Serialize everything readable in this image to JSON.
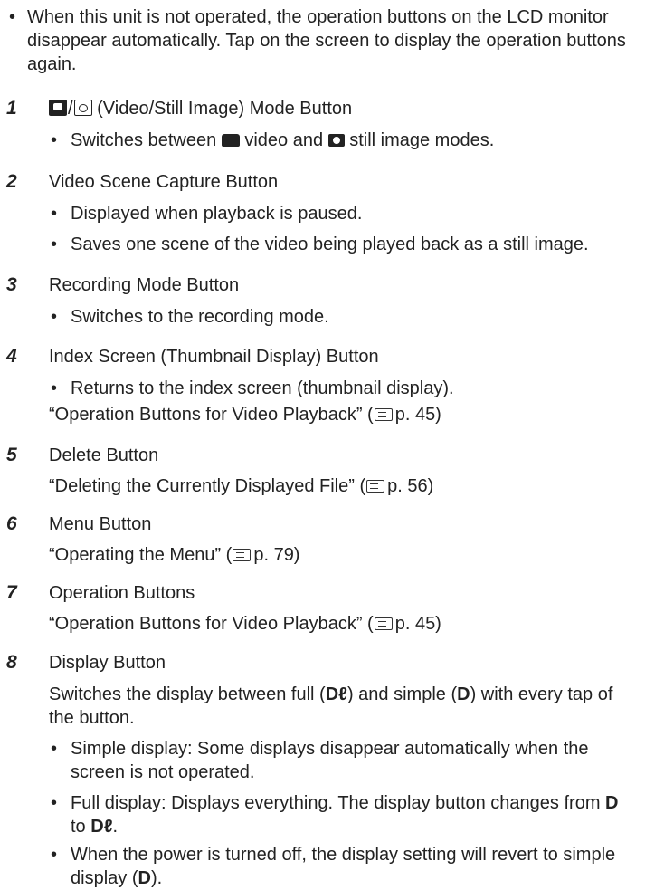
{
  "intro": "When this unit is not operated, the operation buttons on the LCD monitor disappear automatically. Tap on the screen to display the operation buttons again.",
  "items": [
    {
      "num": "1",
      "title": "(Video/Still Image) Mode Button",
      "icons": [
        "video-mode-icon",
        "still-mode-icon"
      ],
      "bullets_a": "Switches between",
      "bullets_b": "video and",
      "bullets_c": "still image modes."
    },
    {
      "num": "2",
      "title": "Video Scene Capture Button",
      "bullets": [
        "Displayed when playback is paused.",
        "Saves one scene of the video being played back as a still image."
      ]
    },
    {
      "num": "3",
      "title": "Recording Mode Button",
      "bullets": [
        "Switches to the recording mode."
      ]
    },
    {
      "num": "4",
      "title": "Index Screen (Thumbnail Display) Button",
      "bullets": [
        "Returns to the index screen (thumbnail display)."
      ],
      "ref_text": "“Operation Buttons for Video Playback” (",
      "ref_page": "p. 45)"
    },
    {
      "num": "5",
      "title": "Delete Button",
      "ref_text": "“Deleting the Currently Displayed File” (",
      "ref_page": "p. 56)"
    },
    {
      "num": "6",
      "title": "Menu Button",
      "ref_text": "“Operating the Menu” (",
      "ref_page": "p. 79)"
    },
    {
      "num": "7",
      "title": "Operation Buttons",
      "ref_text": "“Operation Buttons for Video Playback” (",
      "ref_page": "p. 45)"
    },
    {
      "num": "8",
      "title": "Display Button",
      "desc_a": "Switches the display between full (",
      "desc_b": ") and simple (",
      "desc_c": ") with every tap of",
      "desc_d": "the button.",
      "full_icon": "D",
      "simple_icon": "D",
      "bullets": [
        "Simple display: Some displays disappear automatically when the",
        "screen is not operated."
      ],
      "full_a": "Full display: Displays everything. The display button changes from",
      "full_b": "to",
      "power_a": "When the power is turned off, the display setting will revert to simple",
      "power_b": "display (",
      "power_c": ")."
    }
  ]
}
